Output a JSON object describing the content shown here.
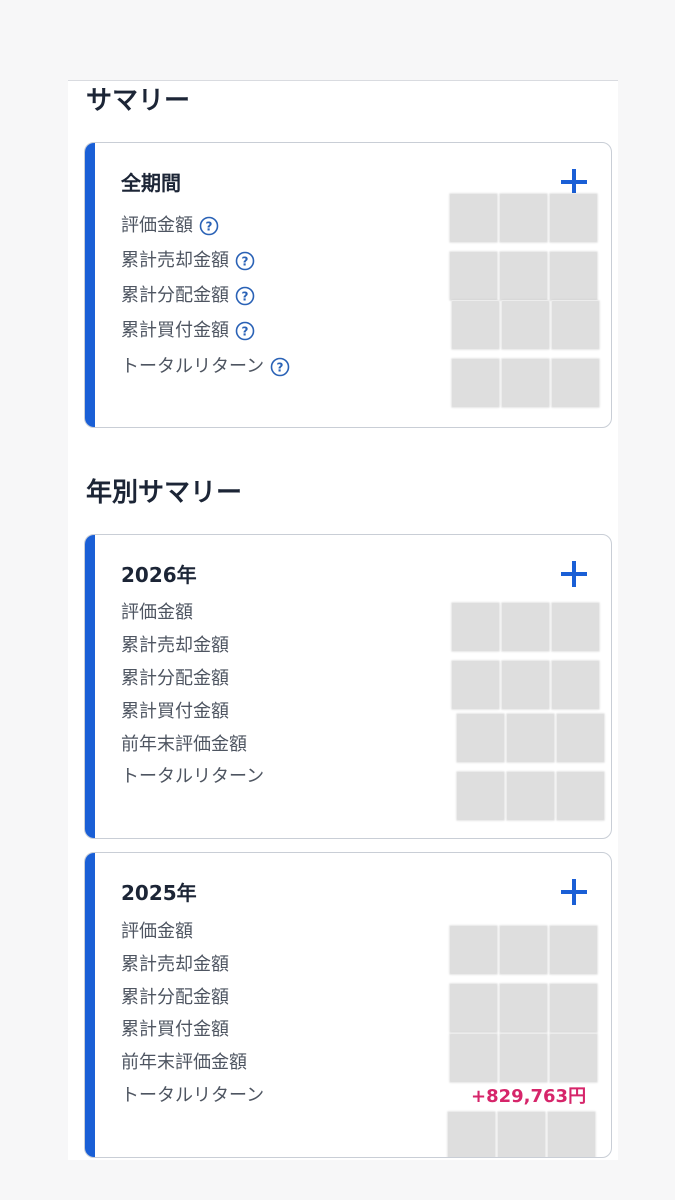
{
  "summary": {
    "title": "サマリー",
    "all_period": {
      "title": "全期間",
      "rows": [
        {
          "label": "評価金額"
        },
        {
          "label": "累計売却金額"
        },
        {
          "label": "累計分配金額"
        },
        {
          "label": "累計買付金額"
        },
        {
          "label": "トータルリターン"
        }
      ]
    }
  },
  "yearly": {
    "title": "年別サマリー",
    "cards": [
      {
        "title": "2026年",
        "rows": [
          {
            "label": "評価金額"
          },
          {
            "label": "累計売却金額"
          },
          {
            "label": "累計分配金額"
          },
          {
            "label": "累計買付金額"
          },
          {
            "label": "前年末評価金額"
          },
          {
            "label": "トータルリターン"
          }
        ]
      },
      {
        "title": "2025年",
        "rows": [
          {
            "label": "評価金額"
          },
          {
            "label": "累計売却金額"
          },
          {
            "label": "累計分配金額"
          },
          {
            "label": "累計買付金額"
          },
          {
            "label": "前年末評価金額"
          },
          {
            "label": "トータルリターン",
            "value": "+829,763円"
          }
        ]
      }
    ]
  },
  "colors": {
    "accent": "#1a5fd6",
    "positive_return": "#d6256a"
  },
  "icons": {
    "expand": "plus-icon",
    "help": "question-circle-icon"
  }
}
